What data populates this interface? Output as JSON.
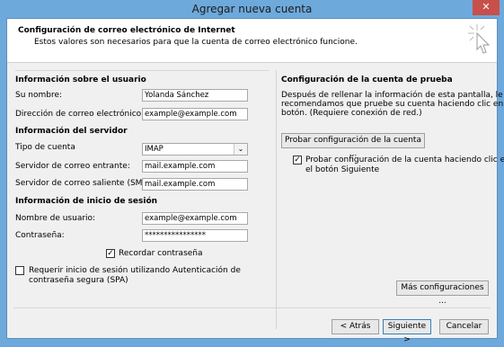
{
  "window": {
    "title": "Agregar nueva cuenta",
    "close_glyph": "✕"
  },
  "header": {
    "title": "Configuración de correo electrónico de Internet",
    "subtitle": "Estos valores son necesarios para que la cuenta de correo electrónico funcione."
  },
  "user_info": {
    "heading": "Información sobre el usuario",
    "name_label": "Su nombre:",
    "name_value": "Yolanda Sánchez",
    "email_label": "Dirección de correo electrónico:",
    "email_value": "example@example.com"
  },
  "server_info": {
    "heading": "Información del servidor",
    "account_type_label": "Tipo de cuenta",
    "account_type_value": "IMAP",
    "incoming_label": "Servidor de correo entrante:",
    "incoming_value": "mail.example.com",
    "outgoing_label": "Servidor de correo saliente (SMTP):",
    "outgoing_value": "mail.example.com"
  },
  "logon_info": {
    "heading": "Información de inicio de sesión",
    "username_label": "Nombre de usuario:",
    "username_value": "example@example.com",
    "password_label": "Contraseña:",
    "password_value": "****************",
    "remember_label": "Recordar contraseña",
    "spa_label_line1": "Requerir inicio de sesión utilizando Autenticación de",
    "spa_label_line2": "contraseña segura (SPA)"
  },
  "test": {
    "heading": "Configuración de la cuenta de prueba",
    "desc_line1": "Después de rellenar la información de esta pantalla, le",
    "desc_line2": "recomendamos que pruebe su cuenta haciendo clic en el",
    "desc_line3": "botón. (Requiere conexión de red.)",
    "test_button": "Probar configuración de la cuenta ...",
    "auto_test_line1": "Probar configuración de la cuenta haciendo clic en",
    "auto_test_line2": "el botón Siguiente"
  },
  "buttons": {
    "more_settings": "Más configuraciones ...",
    "back": "< Atrás",
    "next": "Siguiente >",
    "cancel": "Cancelar"
  },
  "checkboxes": {
    "remember": true,
    "spa": false,
    "auto_test": true
  },
  "colors": {
    "titlebar": "#6ea9dc",
    "close": "#c7504a",
    "panel": "#f0f0f0"
  }
}
